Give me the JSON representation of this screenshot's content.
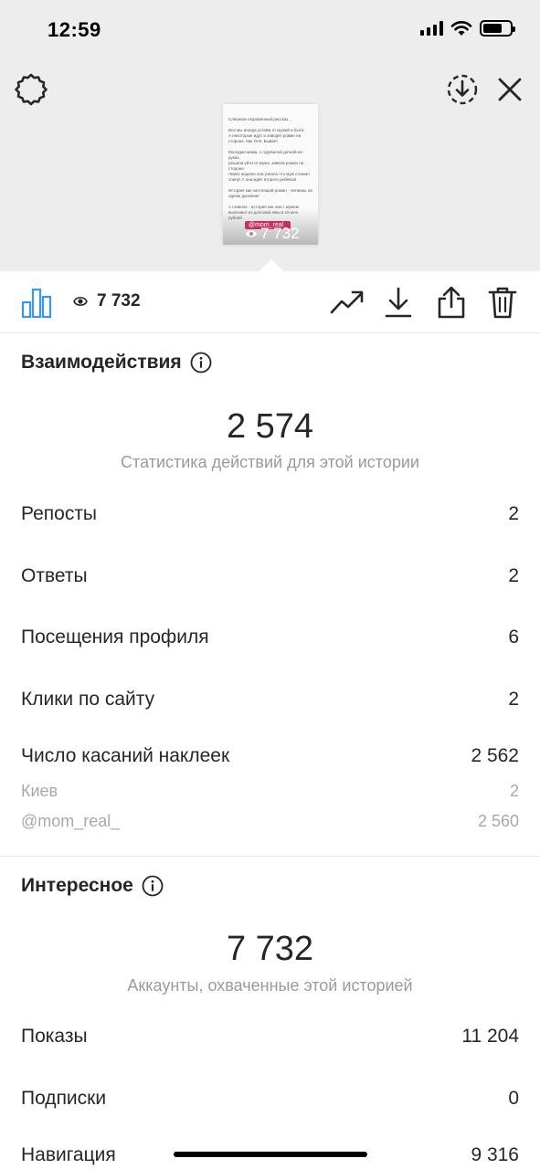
{
  "status_bar": {
    "time": "12:59"
  },
  "story_preview": {
    "text": "Слишком откровенный рассказ...\n\nВсе мы иногда устаём от мужей и быта.\nА некоторые идут и заводят роман на\nстороне. Как Оля. Бывает.\n\nМолодая мама, с годовалой дочкой на руках,\nрешила уйти от мужа, завела роман на\nстороне.\nЧерез неделю она узнала что муж сломал\nспину! А она ждёт второго ребёнка!\n\nИстория как настоящий роман - читаешь на\nодном дыхании!\n\nА главное - история как они с мужем\nвылезают из долговой ямы в 15 млн рублей",
    "tag": "@mom_real_",
    "views": "7 732"
  },
  "toolbar": {
    "views": "7 732"
  },
  "interactions": {
    "title": "Взаимодействия",
    "total": "2 574",
    "caption": "Статистика действий для этой истории",
    "rows": [
      {
        "label": "Репосты",
        "value": "2"
      },
      {
        "label": "Ответы",
        "value": "2"
      },
      {
        "label": "Посещения профиля",
        "value": "6"
      },
      {
        "label": "Клики по сайту",
        "value": "2"
      },
      {
        "label": "Число касаний наклеек",
        "value": "2 562"
      }
    ],
    "sub_rows": [
      {
        "label": "Киев",
        "value": "2"
      },
      {
        "label": "@mom_real_",
        "value": "2 560"
      }
    ]
  },
  "discovery": {
    "title": "Интересное",
    "total": "7 732",
    "caption": "Аккаунты, охваченные этой историей",
    "rows": [
      {
        "label": "Показы",
        "value": "11 204"
      },
      {
        "label": "Подписки",
        "value": "0"
      },
      {
        "label": "Навигация",
        "value": "9 316"
      }
    ]
  },
  "colors": {
    "accent": "#3897f0",
    "top_background": "#ededed",
    "text": "#262626",
    "secondary_text": "#9a9a9a",
    "story_tag": "#c4305f"
  }
}
